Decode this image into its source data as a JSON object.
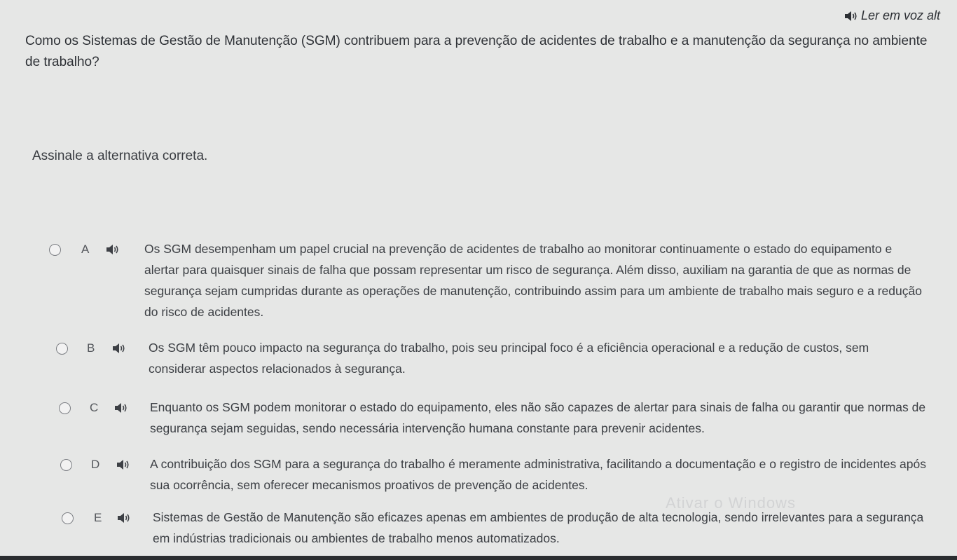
{
  "read_aloud": {
    "label": "Ler em voz alt",
    "icon": "speaker-icon"
  },
  "question": {
    "text": "Como os Sistemas de Gestão de Manutenção (SGM) contribuem para a prevenção de acidentes de trabalho e a manutenção da segurança no ambiente de trabalho?"
  },
  "instruction": "Assinale a alternativa correta.",
  "options": [
    {
      "letter": "A",
      "text": "Os SGM desempenham um papel crucial na prevenção de acidentes de trabalho ao monitorar continuamente o estado do equipamento e alertar para quaisquer sinais de falha que possam representar um risco de segurança. Além disso, auxiliam na garantia de que as normas de segurança sejam cumpridas durante as operações de manutenção, contribuindo assim para um ambiente de trabalho mais seguro e a redução do risco de acidentes."
    },
    {
      "letter": "B",
      "text": "Os SGM têm pouco impacto na segurança do trabalho, pois seu principal foco é a eficiência operacional e a redução de custos, sem considerar aspectos relacionados à segurança."
    },
    {
      "letter": "C",
      "text": "Enquanto os SGM podem monitorar o estado do equipamento, eles não são capazes de alertar para sinais de falha ou garantir que normas de segurança sejam seguidas, sendo necessária intervenção humana constante para prevenir acidentes."
    },
    {
      "letter": "D",
      "text": "A contribuição dos SGM para a segurança do trabalho é meramente administrativa, facilitando a documentação e o registro de incidentes após sua ocorrência, sem oferecer mecanismos proativos de prevenção de acidentes."
    },
    {
      "letter": "E",
      "text": "Sistemas de Gestão de Manutenção são eficazes apenas em ambientes de produção de alta tecnologia, sendo irrelevantes para a segurança em indústrias tradicionais ou ambientes de trabalho menos automatizados."
    }
  ],
  "watermark": "Ativar o Windows",
  "colors": {
    "background": "#e6e7e6",
    "text": "#3a3d42"
  }
}
